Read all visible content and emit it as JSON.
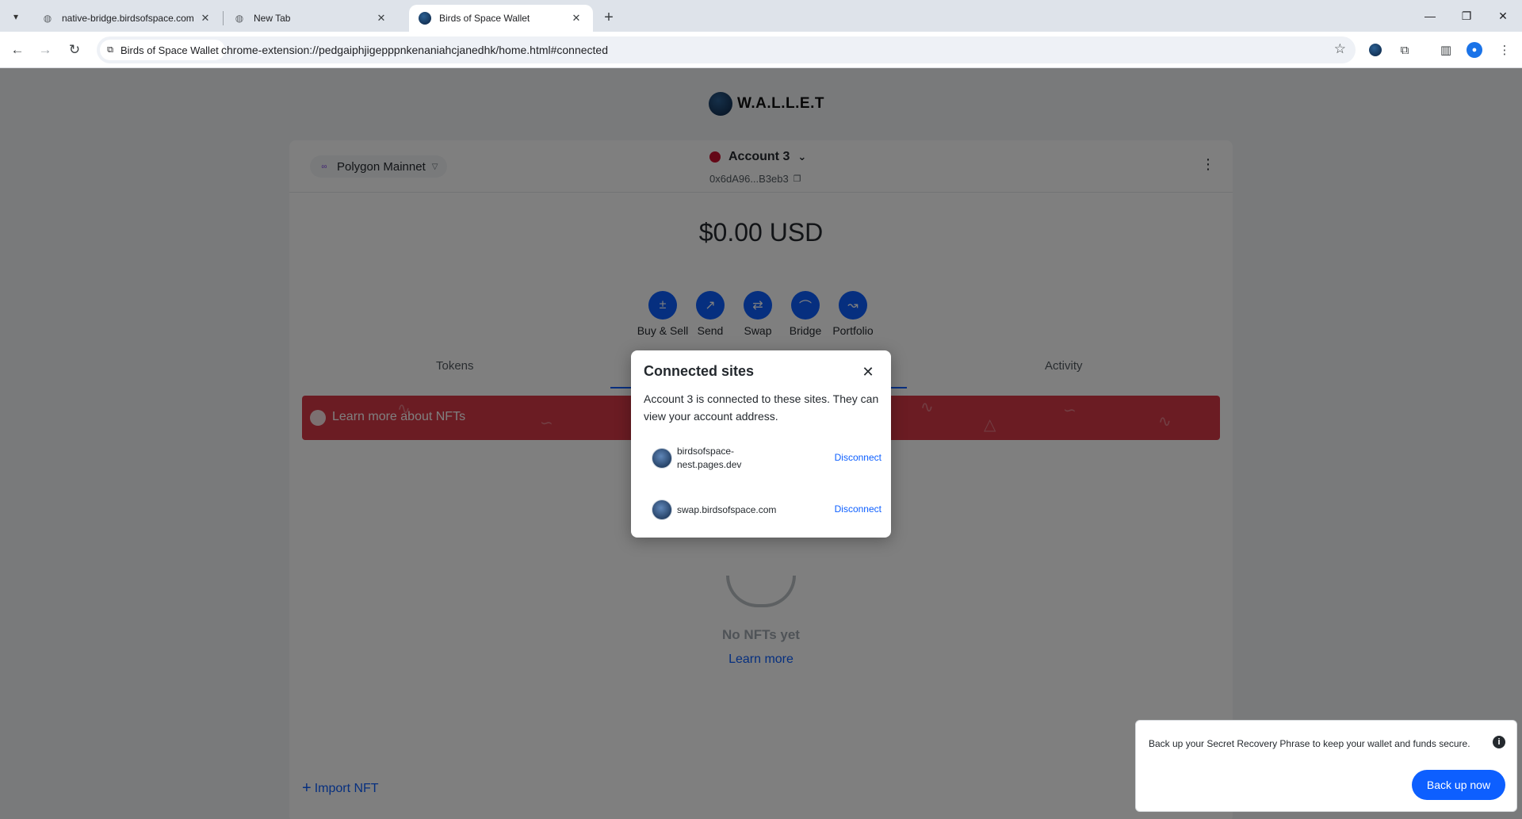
{
  "browser": {
    "tabs": [
      {
        "title": "native-bridge.birdsofspace.com",
        "icon": "globe-icon"
      },
      {
        "title": "New Tab",
        "icon": "chrome-icon"
      },
      {
        "title": "Birds of Space Wallet",
        "icon": "wallet-logo-icon"
      }
    ],
    "active_tab": 2,
    "site_chip": "Birds of Space Wallet",
    "url": "chrome-extension://pedgaiphjigepppnkenaniahcjanedhk/home.html#connected"
  },
  "wallet": {
    "brand": "W.A.L.L.E.T",
    "network": "Polygon Mainnet",
    "account_name": "Account 3",
    "account_address": "0x6dA96...B3eb3",
    "balance": "$0.00 USD",
    "actions": [
      {
        "label": "Buy & Sell",
        "icon": "buy-sell-icon"
      },
      {
        "label": "Send",
        "icon": "send-arrow-icon"
      },
      {
        "label": "Swap",
        "icon": "swap-icon"
      },
      {
        "label": "Bridge",
        "icon": "bridge-icon"
      },
      {
        "label": "Portfolio",
        "icon": "chart-icon"
      }
    ],
    "tabs": {
      "tokens": "Tokens",
      "activity": "Activity"
    },
    "banner_text": "Learn more about NFTs",
    "empty_title": "No NFTs yet",
    "learn_more": "Learn more",
    "import_nft": "Import NFT"
  },
  "modal": {
    "title": "Connected sites",
    "description": "Account 3 is connected to these sites. They can view your account address.",
    "sites": [
      {
        "line1": "birdsofspace-",
        "line2": "nest.pages.dev",
        "action": "Disconnect"
      },
      {
        "line1": "swap.birdsofspace.com",
        "line2": "",
        "action": "Disconnect"
      }
    ]
  },
  "toast": {
    "message": "Back up your Secret Recovery Phrase to keep your wallet and funds secure.",
    "button": "Back up now"
  },
  "colors": {
    "accent": "#0d5fff",
    "banner": "#d73847",
    "account_dot": "#c8102e",
    "polygon": "#8247e5"
  }
}
